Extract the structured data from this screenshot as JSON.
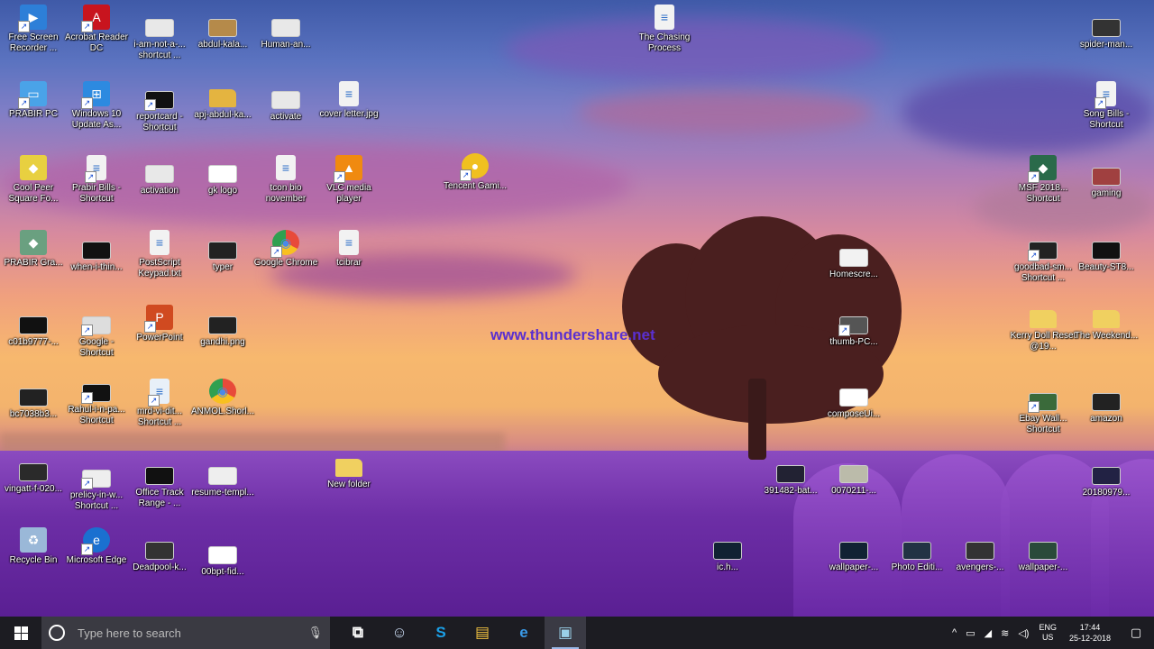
{
  "watermark": "www.thundershare.net",
  "desktop_icons": [
    {
      "label": "Free Screen Recorder ...",
      "icon": "recorder-icon",
      "color": "#2d7fd8"
    },
    {
      "label": "Acrobat Reader DC",
      "icon": "acrobat-icon",
      "color": "#c8141e"
    },
    {
      "label": "i-am-not-a-... shortcut ...",
      "icon": "image-file-icon",
      "color": "#e8e8e8"
    },
    {
      "label": "abdul-kala...",
      "icon": "image-file-icon",
      "color": "#b58a4a"
    },
    {
      "label": "Human-an...",
      "icon": "image-file-icon",
      "color": "#e8e8e8"
    },
    {
      "label": "The Chasing Process",
      "icon": "document-icon",
      "color": "#f2f2f2"
    },
    {
      "label": "spider-man...",
      "icon": "image-file-icon",
      "color": "#333"
    },
    {
      "label": "PRABIR PC",
      "icon": "computer-icon",
      "color": "#4aa3e8"
    },
    {
      "label": "Windows 10 Update As...",
      "icon": "windows-icon",
      "color": "#2d8ae0"
    },
    {
      "label": "reportcard - Shortcut",
      "icon": "image-file-icon",
      "color": "#111"
    },
    {
      "label": "apj-abdul-ka...",
      "icon": "folder-icon",
      "color": "#e4b440"
    },
    {
      "label": "activate",
      "icon": "image-file-icon",
      "color": "#e8e8e8"
    },
    {
      "label": "cover letter.jpg",
      "icon": "document-icon",
      "color": "#f2f2f2"
    },
    {
      "label": "Song Bills - Shortcut",
      "icon": "document-icon",
      "color": "#f2f2f2"
    },
    {
      "label": "Cool Peer Square Fo...",
      "icon": "app-icon",
      "color": "#e8d040"
    },
    {
      "label": "Prabir Bills - Shortcut",
      "icon": "document-icon",
      "color": "#f2f2f2"
    },
    {
      "label": "activation",
      "icon": "image-file-icon",
      "color": "#e8e8e8"
    },
    {
      "label": "gk logo",
      "icon": "image-file-icon",
      "color": "#fff"
    },
    {
      "label": "tcon bio november",
      "icon": "document-icon",
      "color": "#f2f2f2"
    },
    {
      "label": "VLC media player",
      "icon": "vlc-icon",
      "color": "#f08a10"
    },
    {
      "label": "Tencent Gami...",
      "icon": "game-icon",
      "color": "#f0c020"
    },
    {
      "label": "MSF 2018... Shortcut",
      "icon": "app-icon",
      "color": "#2a6a4a"
    },
    {
      "label": "gaming",
      "icon": "image-file-icon",
      "color": "#a04040"
    },
    {
      "label": "PRABIR Gra...",
      "icon": "app-icon",
      "color": "#6aa080"
    },
    {
      "label": "when-i-thin...",
      "icon": "image-file-icon",
      "color": "#111"
    },
    {
      "label": "PostScript Keypad.txt",
      "icon": "text-file-icon",
      "color": "#f2f2f2"
    },
    {
      "label": "typer",
      "icon": "image-file-icon",
      "color": "#222"
    },
    {
      "label": "Google Chrome",
      "icon": "chrome-icon",
      "color": "#e84a3a"
    },
    {
      "label": "tcibrar",
      "icon": "document-icon",
      "color": "#f2f2f2"
    },
    {
      "label": "Homescre...",
      "icon": "image-file-icon",
      "color": "#f2f2f2"
    },
    {
      "label": "goodbad-sm... Shortcut ...",
      "icon": "image-file-icon",
      "color": "#222"
    },
    {
      "label": "Beauty-ST8...",
      "icon": "image-file-icon",
      "color": "#111"
    },
    {
      "label": "c01b9777-...",
      "icon": "image-file-icon",
      "color": "#111"
    },
    {
      "label": "Google - Shortcut",
      "icon": "image-file-icon",
      "color": "#ddd"
    },
    {
      "label": "PowerPoint",
      "icon": "powerpoint-icon",
      "color": "#d04a20"
    },
    {
      "label": "gandhi.png",
      "icon": "image-file-icon",
      "color": "#222"
    },
    {
      "label": "thumb-PC...",
      "icon": "image-file-icon",
      "color": "#555"
    },
    {
      "label": "Kerry Doll Reset @19...",
      "icon": "folder-icon",
      "color": "#f0d060"
    },
    {
      "label": "The Weekend...",
      "icon": "folder-icon",
      "color": "#f0d060"
    },
    {
      "label": "bc7038b3...",
      "icon": "image-file-icon",
      "color": "#222"
    },
    {
      "label": "Rahul-i-n-pa... Shortcut",
      "icon": "image-file-icon",
      "color": "#111"
    },
    {
      "label": "mrd-vi-dit... Shortcut ...",
      "icon": "document-icon",
      "color": "#e8f0f8"
    },
    {
      "label": "ANMOL.Shorl...",
      "icon": "chrome-icon",
      "color": "#e84a3a"
    },
    {
      "label": "composeUi...",
      "icon": "image-file-icon",
      "color": "#fff"
    },
    {
      "label": "Ebay Wall... Shortcut",
      "icon": "image-file-icon",
      "color": "#3a6a3a"
    },
    {
      "label": "amazon",
      "icon": "image-file-icon",
      "color": "#222"
    },
    {
      "label": "vingatt-f-020...",
      "icon": "image-file-icon",
      "color": "#2a2a2a"
    },
    {
      "label": "prelicy-in-w... Shortcut ...",
      "icon": "image-file-icon",
      "color": "#eee"
    },
    {
      "label": "Office Track Range - ...",
      "icon": "image-file-icon",
      "color": "#111"
    },
    {
      "label": "resume-templ...",
      "icon": "image-file-icon",
      "color": "#eee"
    },
    {
      "label": "New folder",
      "icon": "folder-icon",
      "color": "#f0d060"
    },
    {
      "label": "391482-bat...",
      "icon": "image-file-icon",
      "color": "#223"
    },
    {
      "label": "0070211-...",
      "icon": "image-file-icon",
      "color": "#bba"
    },
    {
      "label": "20180979...",
      "icon": "image-file-icon",
      "color": "#224"
    },
    {
      "label": "Recycle Bin",
      "icon": "recycle-bin-icon",
      "color": "#9ab8d8"
    },
    {
      "label": "Microsoft Edge",
      "icon": "edge-icon",
      "color": "#1a70d0"
    },
    {
      "label": "Deadpool-k...",
      "icon": "image-file-icon",
      "color": "#333"
    },
    {
      "label": "00bpt-fid...",
      "icon": "image-file-icon",
      "color": "#fff"
    },
    {
      "label": "ic.h...",
      "icon": "image-file-icon",
      "color": "#123"
    },
    {
      "label": "wallpaper-...",
      "icon": "image-file-icon",
      "color": "#123"
    },
    {
      "label": "Photo Editi...",
      "icon": "image-file-icon",
      "color": "#234"
    },
    {
      "label": "avengers-...",
      "icon": "image-file-icon",
      "color": "#333"
    },
    {
      "label": "wallpaper-...",
      "icon": "image-file-icon",
      "color": "#2a4a3a"
    }
  ],
  "taskbar": {
    "search_placeholder": "Type here to search",
    "apps": [
      {
        "name": "task-view-icon",
        "glyph": "⧉",
        "open": false,
        "active": false
      },
      {
        "name": "people-app-icon",
        "glyph": "☺",
        "open": false,
        "active": false
      },
      {
        "name": "skype-icon",
        "glyph": "S",
        "open": false,
        "active": false
      },
      {
        "name": "file-explorer-icon",
        "glyph": "▤",
        "open": false,
        "active": false
      },
      {
        "name": "edge-icon",
        "glyph": "e",
        "open": false,
        "active": false
      },
      {
        "name": "screen-recorder-icon",
        "glyph": "▣",
        "open": true,
        "active": true
      }
    ],
    "language": "ENG",
    "region": "US",
    "time": "17:44",
    "date": "25-12-2018"
  }
}
